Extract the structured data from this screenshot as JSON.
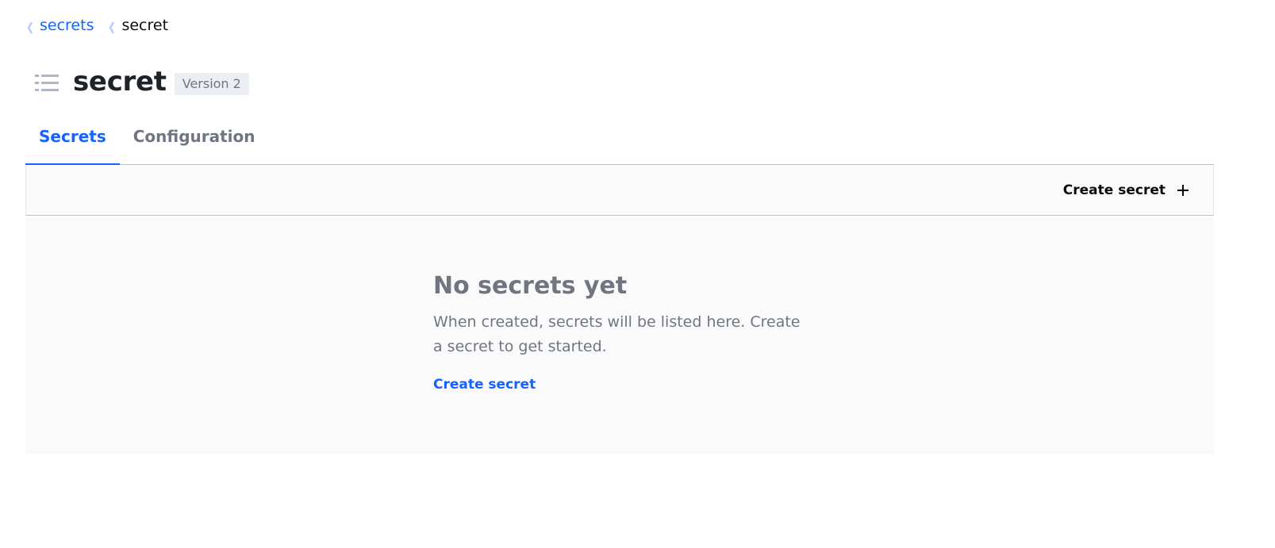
{
  "breadcrumb": {
    "items": [
      {
        "label": "secrets",
        "link": true
      },
      {
        "label": "secret",
        "link": false
      }
    ]
  },
  "header": {
    "title": "secret",
    "version_badge": "Version 2"
  },
  "tabs": [
    {
      "label": "Secrets",
      "active": true
    },
    {
      "label": "Configuration",
      "active": false
    }
  ],
  "toolbar": {
    "create_label": "Create secret"
  },
  "empty_state": {
    "title": "No secrets yet",
    "message": "When created, secrets will be listed here. Create a secret to get started.",
    "action_label": "Create secret"
  },
  "colors": {
    "accent": "#1563ff",
    "muted_text": "#6f7682",
    "panel_bg": "#fafafa",
    "badge_bg": "#ebeef2"
  },
  "icons": [
    "chevron-left-icon",
    "list-icon",
    "plus-icon"
  ]
}
